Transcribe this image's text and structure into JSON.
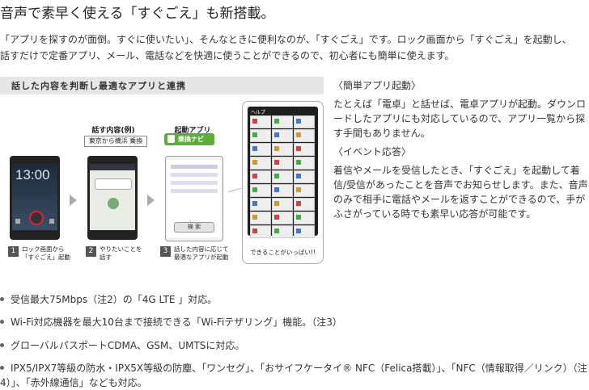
{
  "heading": "音声で素早く使える「すぐごえ」も新搭載。",
  "intro": {
    "line1": "「アプリを探すのが面倒。すぐに使いたい」、そんなときに便利なのが、「すぐごえ」です。ロック画面から「すぐごえ」を起動し、",
    "line2": "話すだけで定番アプリ、メール、電話などを快適に使うことができるので、初心者にも簡単に使えます。"
  },
  "figure": {
    "title": "話した内容を判断し最適なアプリと連携",
    "col_speech": "話す内容(例)",
    "col_app": "起動アプリ",
    "speech_example": "東京から横浜 乗換",
    "app_example": "乗換ナビ",
    "clock": "13:00",
    "steps": [
      {
        "num": "1",
        "line1": "ロック画面から",
        "line2": "「すぐごえ」起動"
      },
      {
        "num": "2",
        "line1": "やりたいことを",
        "line2": "話す"
      },
      {
        "num": "3",
        "line1": "話した内容に応じて",
        "line2": "最適なアプリが起動"
      }
    ],
    "search_button": "検 索",
    "help_title": "ヘルプ",
    "card_caption": "できることがいっぱい!!"
  },
  "right": {
    "sec1_title": "〈簡単アプリ起動〉",
    "sec1_body": "たとえば「電卓」と話せば、電卓アプリが起動。ダウンロードしたアプリにも対応しているので、アプリ一覧から探す手間もありません。",
    "sec2_title": "〈イベント応答〉",
    "sec2_body": "着信やメールを受信したとき、「すぐごえ」を起動して着信/受信があったことを音声でお知らせします。また、音声のみで相手に電話やメールを返すことができるので、手がふさがっている時でも素早い応答が可能です。"
  },
  "bullets": [
    "受信最大75Mbps（注2）の「4G LTE 」対応。",
    "Wi-Fi対応機器を最大10台まで接続できる「Wi-Fiテザリング」機能。（注3）",
    "グローバルパスポートCDMA、GSM、UMTSに対応。",
    "IPX5/IPX7等級の防水・IPX5X等級の防塵、「ワンセグ」、「おサイフケータイ® NFC（Felica搭載）」、「NFC（情報取得／リンク）（注4）」、「赤外線通信」なども対応。"
  ],
  "colors": {
    "accent_green": "#5cae3a",
    "title_bar": "#e6e6e6",
    "step_box": "#555555"
  }
}
